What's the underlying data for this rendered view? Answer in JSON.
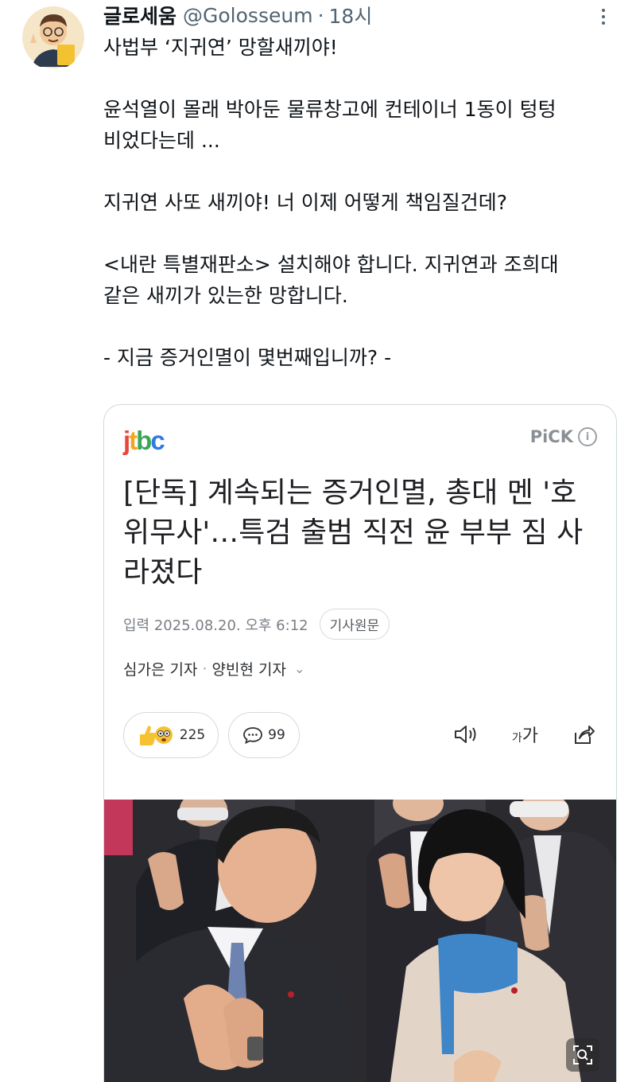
{
  "author": {
    "name": "글로세움",
    "handle": "@Golosseum",
    "separator": "·",
    "time": "18시"
  },
  "tweet": {
    "lines": [
      "사법부 ‘지귀연’ 망할새끼야!",
      "윤석열이 몰래 박아둔 물류창고에 컨테이너 1동이 텅텅",
      "비었다는데 ...",
      "지귀연 사또 새끼야! 너 이제 어떻게 책임질건데?",
      "<내란 특별재판소> 설치해야 합니다. 지귀연과 조희대",
      "같은 새끼가 있는한 망합니다.",
      "- 지금 증거인멸이 몇번째입니까? -"
    ]
  },
  "card": {
    "source_logo": "jtbc",
    "pick_label": "PiCK",
    "info_icon_text": "i",
    "headline": "[단독] 계속되는 증거인멸, 총대 멘 '호위무사'…특검 출범 직전 윤 부부 짐 사라졌다",
    "date": "입력 2025.08.20. 오후 6:12",
    "original_button": "기사원문",
    "reporter1": "심가은 기자",
    "byline_sep": "·",
    "reporter2": "양빈현 기자",
    "reaction_count": "225",
    "comment_count": "99",
    "font_size_label": "가",
    "font_size_small": "가"
  },
  "colors": {
    "text": "#0f1419",
    "secondary": "#536471",
    "card_border": "#cfd9de",
    "jtbc_colors": [
      "#e8453c",
      "#f4a51c",
      "#3aa655",
      "#2f7ae5"
    ]
  }
}
